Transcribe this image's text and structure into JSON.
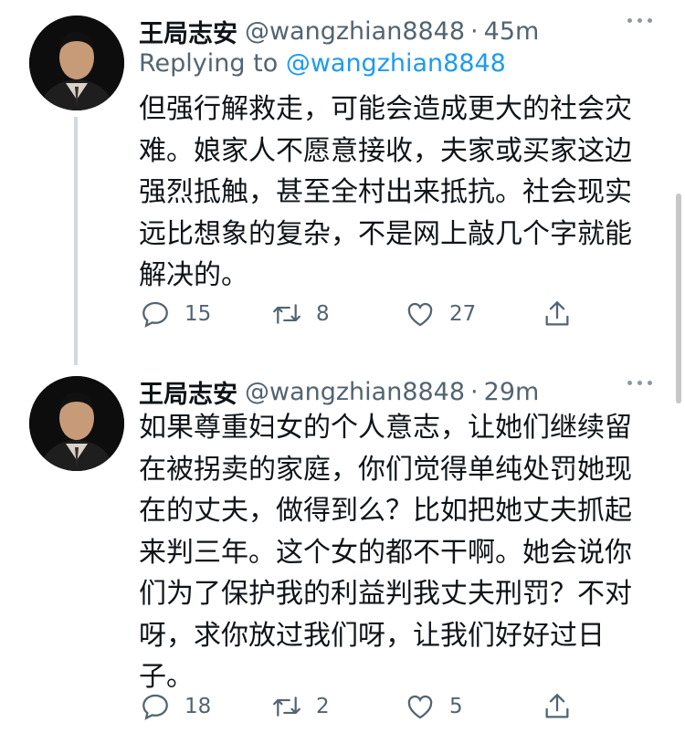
{
  "tweets": [
    {
      "author_name": "王局志安",
      "handle": "@wangzhian8848",
      "separator": "·",
      "time": "45m",
      "replying_prefix": "Replying to ",
      "replying_to": "@wangzhian8848",
      "text": "但强行解救走，可能会造成更大的社会灾难。娘家人不愿意接收，夫家或买家这边强烈抵触，甚至全村出来抵抗。社会现实远比想象的复杂，不是网上敲几个字就能解决的。",
      "replies": "15",
      "retweets": "8",
      "likes": "27"
    },
    {
      "author_name": "王局志安",
      "handle": "@wangzhian8848",
      "separator": "·",
      "time": "29m",
      "text": "如果尊重妇女的个人意志，让她们继续留在被拐卖的家庭，你们觉得单纯处罚她现在的丈夫，做得到么？比如把她丈夫抓起来判三年。这个女的都不干啊。她会说你们为了保护我的利益判我丈夫刑罚？不对呀，求你放过我们呀，让我们好好过日子。",
      "replies": "18",
      "retweets": "2",
      "likes": "5"
    }
  ],
  "icons": {
    "reply": "reply-icon",
    "retweet": "retweet-icon",
    "like": "heart-icon",
    "share": "share-icon",
    "more": "more-icon"
  },
  "colors": {
    "link": "#1d9bf0",
    "secondary": "#536471",
    "thread_line": "#cfd9de"
  }
}
